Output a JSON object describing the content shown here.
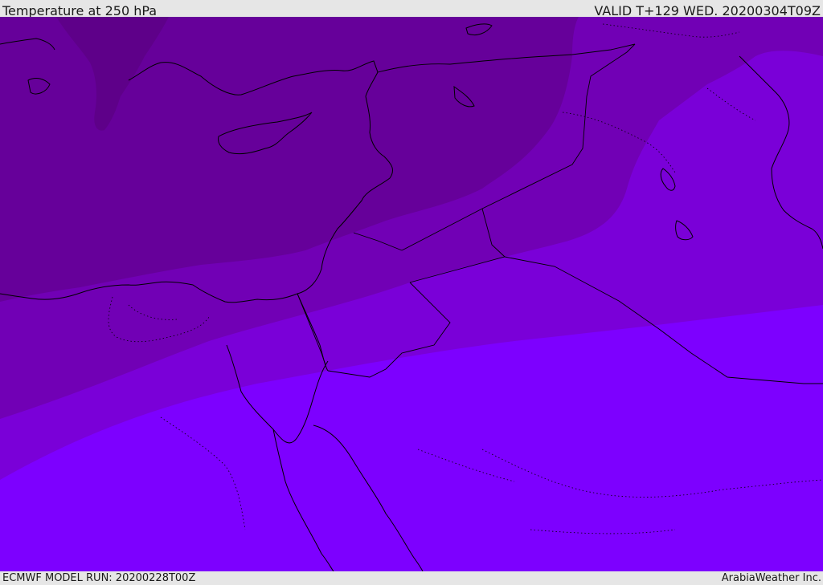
{
  "header": {
    "title": "Temperature at 250 hPa",
    "valid": "VALID T+129 WED. 20200304T09Z"
  },
  "footer": {
    "model_run": "ECMWF MODEL RUN: 20200228T00Z",
    "credit": "ArabiaWeather Inc."
  },
  "colors": {
    "band_darkest": "#5e0089",
    "band_dark": "#66009a",
    "band_mid": "#7100b5",
    "band_light": "#7a00d8",
    "band_lightest": "#7d00ff",
    "coastline": "#000000"
  }
}
